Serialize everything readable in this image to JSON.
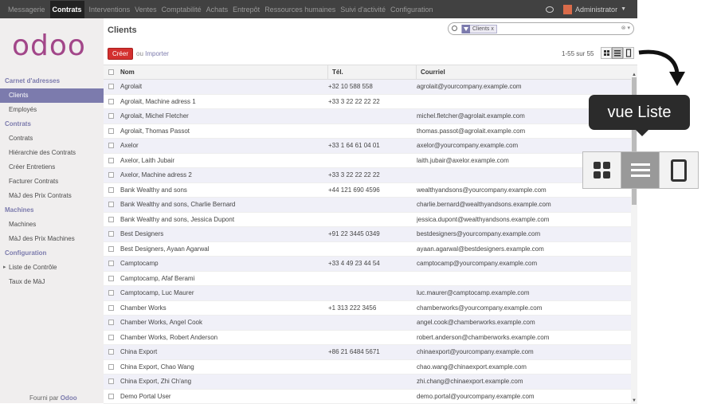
{
  "topbar": {
    "menu": [
      "Messagerie",
      "Contrats",
      "Interventions",
      "Ventes",
      "Comptabilité",
      "Achats",
      "Entrepôt",
      "Ressources humaines",
      "Suivi d'activité",
      "Configuration"
    ],
    "active": "Contrats",
    "user": "Administrator"
  },
  "sidebar": {
    "logo": "odoo",
    "groups": [
      {
        "title": "Carnet d'adresses",
        "items": [
          "Clients",
          "Employés"
        ]
      },
      {
        "title": "Contrats",
        "items": [
          "Contrats",
          "Hiérarchie des Contrats",
          "Créer Entretiens",
          "Facturer Contrats",
          "MàJ des Prix Contrats"
        ]
      },
      {
        "title": "Machines",
        "items": [
          "Machines",
          "MàJ des Prix Machines"
        ]
      },
      {
        "title": "Configuration",
        "items": [
          "Liste de Contrôle",
          "Taux de MàJ"
        ]
      }
    ],
    "active_item": "Clients",
    "footer_prefix": "Fourni par",
    "footer_brand": "Odoo"
  },
  "main": {
    "title": "Clients",
    "search_filter": "Clients",
    "create_label": "Créer",
    "or_label": "ou",
    "import_label": "Importer",
    "pager": "1-55 sur 55",
    "columns": [
      "Nom",
      "Tél.",
      "Courriel"
    ],
    "rows": [
      [
        "Agrolait",
        "+32 10 588 558",
        "agrolait@yourcompany.example.com"
      ],
      [
        "Agrolait, Machine adress 1",
        "+33 3 22 22 22 22",
        ""
      ],
      [
        "Agrolait, Michel Fletcher",
        "",
        "michel.fletcher@agrolait.example.com"
      ],
      [
        "Agrolait, Thomas Passot",
        "",
        "thomas.passot@agrolait.example.com"
      ],
      [
        "Axelor",
        "+33 1 64 61 04 01",
        "axelor@yourcompany.example.com"
      ],
      [
        "Axelor, Laith Jubair",
        "",
        "laith.jubair@axelor.example.com"
      ],
      [
        "Axelor, Machine adress 2",
        "+33 3 22 22 22 22",
        ""
      ],
      [
        "Bank Wealthy and sons",
        "+44 121 690 4596",
        "wealthyandsons@yourcompany.example.com"
      ],
      [
        "Bank Wealthy and sons, Charlie Bernard",
        "",
        "charlie.bernard@wealthyandsons.example.com"
      ],
      [
        "Bank Wealthy and sons, Jessica Dupont",
        "",
        "jessica.dupont@wealthyandsons.example.com"
      ],
      [
        "Best Designers",
        "+91 22 3445 0349",
        "bestdesigners@yourcompany.example.com"
      ],
      [
        "Best Designers, Ayaan Agarwal",
        "",
        "ayaan.agarwal@bestdesigners.example.com"
      ],
      [
        "Camptocamp",
        "+33 4 49 23 44 54",
        "camptocamp@yourcompany.example.com"
      ],
      [
        "Camptocamp, Afaf Berami",
        "",
        ""
      ],
      [
        "Camptocamp, Luc Maurer",
        "",
        "luc.maurer@camptocamp.example.com"
      ],
      [
        "Chamber Works",
        "+1 313 222 3456",
        "chamberworks@yourcompany.example.com"
      ],
      [
        "Chamber Works, Angel Cook",
        "",
        "angel.cook@chamberworks.example.com"
      ],
      [
        "Chamber Works, Robert Anderson",
        "",
        "robert.anderson@chamberworks.example.com"
      ],
      [
        "China Export",
        "+86 21 6484 5671",
        "chinaexport@yourcompany.example.com"
      ],
      [
        "China Export, Chao Wang",
        "",
        "chao.wang@chinaexport.example.com"
      ],
      [
        "China Export, Zhi Ch'ang",
        "",
        "zhi.chang@chinaexport.example.com"
      ],
      [
        "Demo Portal User",
        "",
        "demo.portal@yourcompany.example.com"
      ]
    ]
  },
  "callout": {
    "tooltip": "vue Liste"
  }
}
